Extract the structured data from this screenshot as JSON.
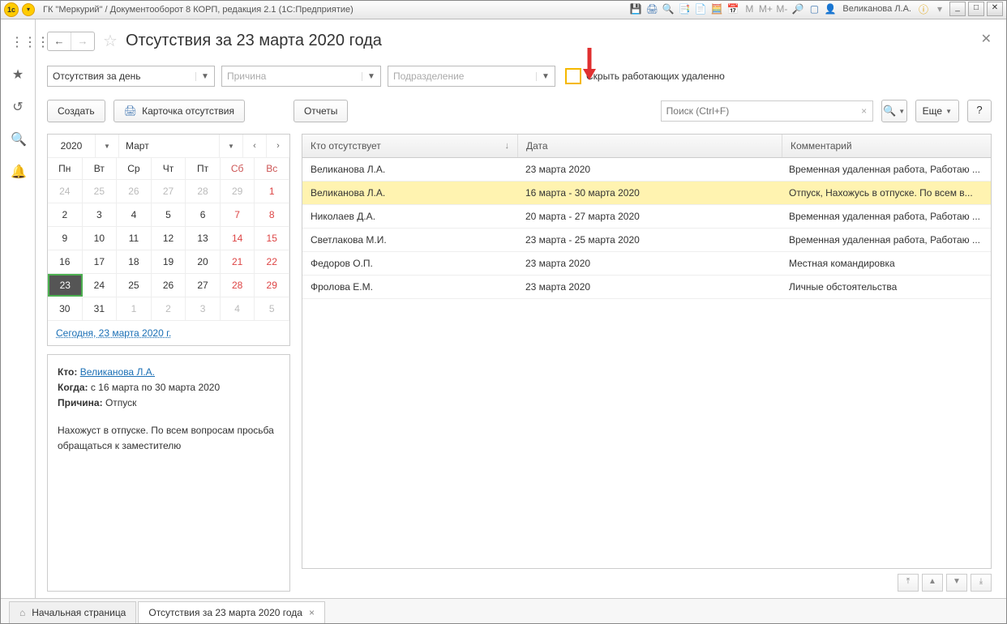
{
  "titlebar": {
    "title": "ГК \"Меркурий\" / Документооборот 8 КОРП, редакция 2.1  (1С:Предприятие)",
    "user": "Великанова Л.А."
  },
  "page": {
    "title": "Отсутствия за 23 марта 2020 года"
  },
  "filters": {
    "period_label": "Отсутствия за день",
    "reason_placeholder": "Причина",
    "dept_placeholder": "Подразделение",
    "hide_remote_label": "Скрыть работающих удаленно"
  },
  "toolbar": {
    "create": "Создать",
    "card": "Карточка отсутствия",
    "reports": "Отчеты",
    "search_placeholder": "Поиск (Ctrl+F)",
    "more": "Еще"
  },
  "calendar": {
    "year": "2020",
    "month": "Март",
    "day_headers": [
      "Пн",
      "Вт",
      "Ср",
      "Чт",
      "Пт",
      "Сб",
      "Вс"
    ],
    "cells": [
      {
        "d": "24",
        "other": true
      },
      {
        "d": "25",
        "other": true
      },
      {
        "d": "26",
        "other": true
      },
      {
        "d": "27",
        "other": true
      },
      {
        "d": "28",
        "other": true
      },
      {
        "d": "29",
        "other": true
      },
      {
        "d": "1",
        "red": true
      },
      {
        "d": "2"
      },
      {
        "d": "3"
      },
      {
        "d": "4"
      },
      {
        "d": "5"
      },
      {
        "d": "6"
      },
      {
        "d": "7",
        "red": true
      },
      {
        "d": "8",
        "red": true
      },
      {
        "d": "9"
      },
      {
        "d": "10"
      },
      {
        "d": "11"
      },
      {
        "d": "12"
      },
      {
        "d": "13"
      },
      {
        "d": "14",
        "red": true
      },
      {
        "d": "15",
        "red": true
      },
      {
        "d": "16"
      },
      {
        "d": "17"
      },
      {
        "d": "18"
      },
      {
        "d": "19"
      },
      {
        "d": "20"
      },
      {
        "d": "21",
        "red": true
      },
      {
        "d": "22",
        "red": true
      },
      {
        "d": "23",
        "today": true
      },
      {
        "d": "24"
      },
      {
        "d": "25"
      },
      {
        "d": "26"
      },
      {
        "d": "27"
      },
      {
        "d": "28",
        "red": true
      },
      {
        "d": "29",
        "red": true
      },
      {
        "d": "30"
      },
      {
        "d": "31"
      },
      {
        "d": "1",
        "other": true
      },
      {
        "d": "2",
        "other": true
      },
      {
        "d": "3",
        "other": true
      },
      {
        "d": "4",
        "other": true
      },
      {
        "d": "5",
        "other": true
      }
    ],
    "today_link": "Сегодня, 23 марта 2020 г."
  },
  "info": {
    "who_label": "Кто:",
    "who_value": "Великанова Л.А.",
    "when_label": "Когда:",
    "when_value": "с 16 марта по 30 марта 2020",
    "reason_label": "Причина:",
    "reason_value": "Отпуск",
    "note": "Нахожуст в отпуске. По всем вопросам просьба обращаться к заместителю"
  },
  "table": {
    "columns": {
      "c1": "Кто отсутствует",
      "c2": "Дата",
      "c3": "Комментарий"
    },
    "rows": [
      {
        "who": "Великанова Л.А.",
        "date": "23 марта 2020",
        "comment": "Временная удаленная работа, Работаю ..."
      },
      {
        "who": "Великанова Л.А.",
        "date": "16 марта - 30 марта 2020",
        "comment": "Отпуск, Нахожусь в отпуске. По всем в...",
        "selected": true
      },
      {
        "who": "Николаев Д.А.",
        "date": "20 марта - 27 марта 2020",
        "comment": "Временная удаленная работа, Работаю ..."
      },
      {
        "who": "Светлакова М.И.",
        "date": "23 марта - 25 марта 2020",
        "comment": "Временная удаленная работа, Работаю ..."
      },
      {
        "who": "Федоров О.П.",
        "date": "23 марта 2020",
        "comment": "Местная командировка"
      },
      {
        "who": "Фролова Е.М.",
        "date": "23 марта 2020",
        "comment": "Личные обстоятельства"
      }
    ]
  },
  "tabs": {
    "home": "Начальная страница",
    "current": "Отсутствия за 23 марта 2020 года"
  }
}
